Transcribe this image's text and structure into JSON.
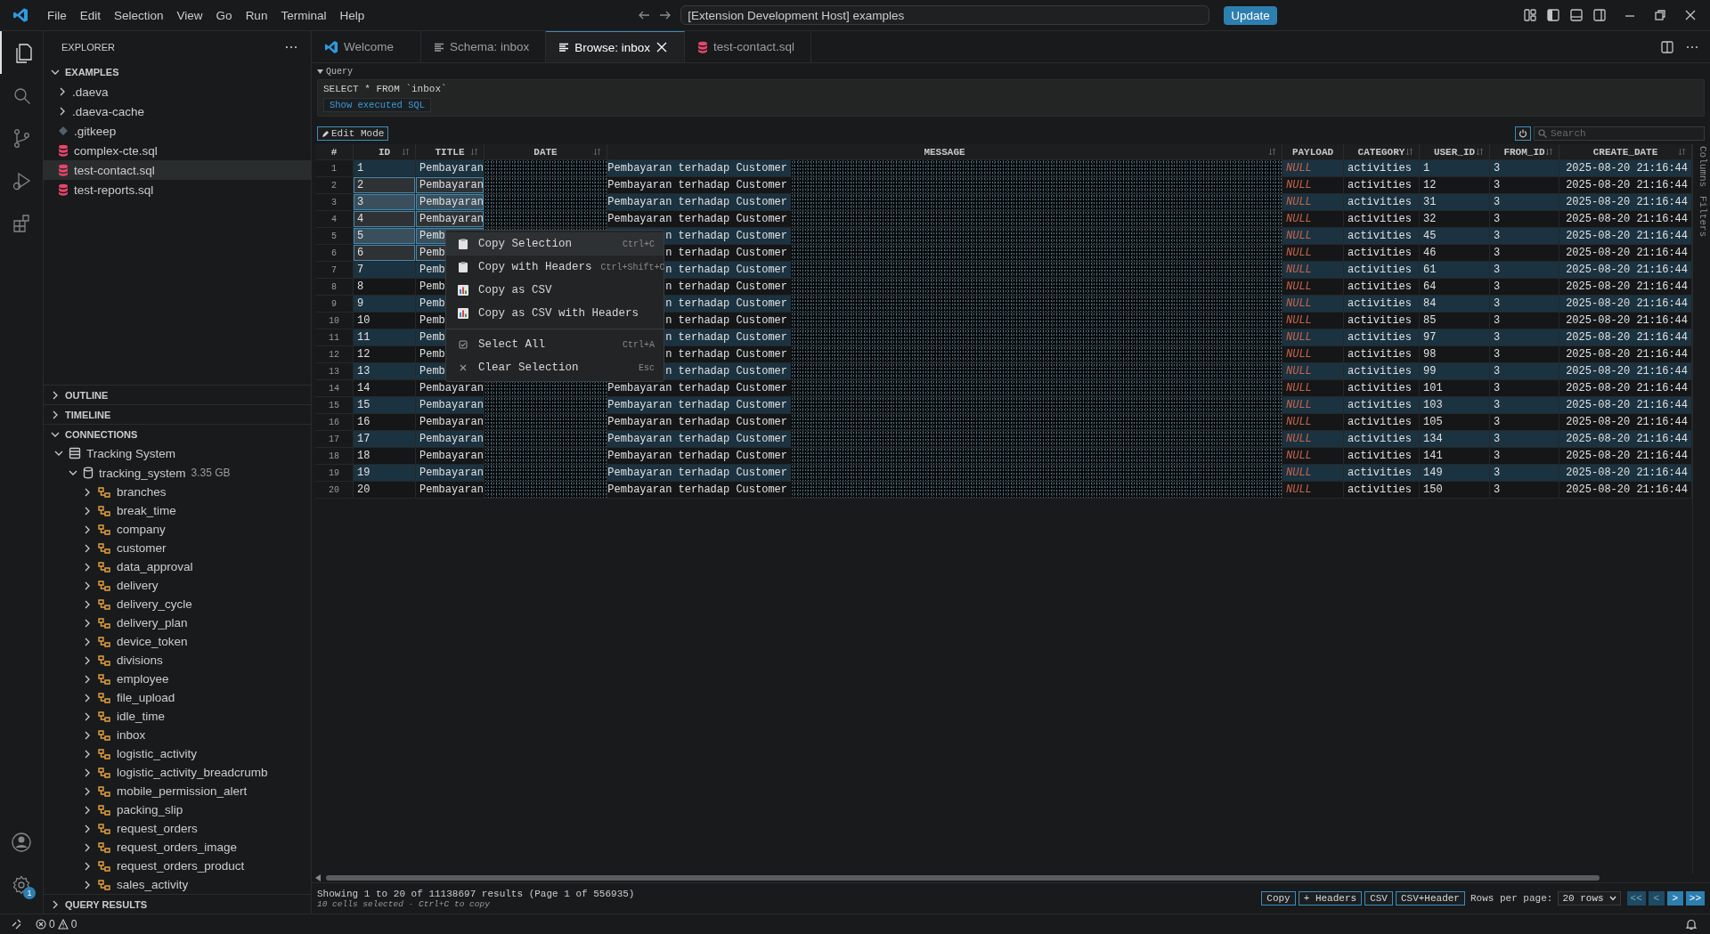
{
  "window": {
    "menu": [
      "File",
      "Edit",
      "Selection",
      "View",
      "Go",
      "Run",
      "Terminal",
      "Help"
    ],
    "command_center": "[Extension Development Host] examples",
    "update_button": "Update"
  },
  "activity_bar": [
    {
      "kind": "files",
      "selected": true
    },
    {
      "kind": "search",
      "selected": false
    },
    {
      "kind": "branch",
      "selected": false
    },
    {
      "kind": "debug",
      "selected": false
    },
    {
      "kind": "extensions",
      "selected": false
    }
  ],
  "settings_badge": "1",
  "sidebar": {
    "title": "EXPLORER",
    "folder": {
      "label": "EXAMPLES",
      "expanded": true,
      "children": [
        {
          "label": ".daeva",
          "kind": "folder",
          "selected": false
        },
        {
          "label": ".daeva-cache",
          "kind": "folder",
          "selected": false
        },
        {
          "label": ".gitkeep",
          "kind": "file",
          "selected": false
        },
        {
          "label": "complex-cte.sql",
          "kind": "sql",
          "selected": false
        },
        {
          "label": "test-contact.sql",
          "kind": "sql",
          "selected": true
        },
        {
          "label": "test-reports.sql",
          "kind": "sql",
          "selected": false
        }
      ]
    },
    "sections": [
      {
        "label": "OUTLINE",
        "expanded": false
      },
      {
        "label": "TIMELINE",
        "expanded": false
      }
    ],
    "connections": {
      "label": "CONNECTIONS",
      "expanded": true,
      "children": [
        {
          "label": "Tracking System",
          "expanded": true,
          "children": [
            {
              "label": "tracking_system",
              "size": "3.35 GB",
              "expanded": true,
              "children": [
                {
                  "label": "branches"
                },
                {
                  "label": "break_time"
                },
                {
                  "label": "company"
                },
                {
                  "label": "customer"
                },
                {
                  "label": "data_approval"
                },
                {
                  "label": "delivery"
                },
                {
                  "label": "delivery_cycle"
                },
                {
                  "label": "delivery_plan"
                },
                {
                  "label": "device_token"
                },
                {
                  "label": "divisions"
                },
                {
                  "label": "employee"
                },
                {
                  "label": "file_upload"
                },
                {
                  "label": "idle_time"
                },
                {
                  "label": "inbox"
                },
                {
                  "label": "logistic_activity"
                },
                {
                  "label": "logistic_activity_breadcrumb"
                },
                {
                  "label": "mobile_permission_alert"
                },
                {
                  "label": "packing_slip"
                },
                {
                  "label": "request_orders"
                },
                {
                  "label": "request_orders_image"
                },
                {
                  "label": "request_orders_product"
                },
                {
                  "label": "sales_activity"
                }
              ]
            }
          ]
        }
      ]
    },
    "bottom_section": {
      "label": "QUERY RESULTS",
      "expanded": false
    }
  },
  "tabs": [
    {
      "label": "Welcome",
      "kind": "vscode",
      "selected": false
    },
    {
      "label": "Schema: inbox",
      "kind": "list",
      "selected": false
    },
    {
      "label": "Browse: inbox",
      "kind": "list",
      "selected": true
    },
    {
      "label": "test-contact.sql",
      "kind": "sql",
      "selected": false
    }
  ],
  "query": {
    "label": "Query",
    "expanded": true,
    "sql": "SELECT * FROM `inbox`",
    "show_sql_button": "Show executed SQL"
  },
  "toolbar": {
    "edit_mode_button": "Edit Mode",
    "search": {
      "placeholder": "Search"
    }
  },
  "side_strip": [
    "Columns",
    "Filters"
  ],
  "table": {
    "columns": [
      {
        "label": "#",
        "sortable": false
      },
      {
        "label": "ID",
        "sortable": true
      },
      {
        "label": "TITLE",
        "sortable": true
      },
      {
        "label": "DATE",
        "sortable": true
      },
      {
        "label": "MESSAGE",
        "sortable": true
      },
      {
        "label": "PAYLOAD",
        "sortable": false
      },
      {
        "label": "CATEGORY",
        "sortable": true
      },
      {
        "label": "USER_ID",
        "sortable": true
      },
      {
        "label": "FROM_ID",
        "sortable": true
      },
      {
        "label": "CREATE_DATE",
        "sortable": true
      }
    ],
    "rows": [
      {
        "no": "1",
        "id": "1",
        "title": "Pembayaran",
        "message": "Pembayaran terhadap Customer",
        "payload": "NULL",
        "category": "activities",
        "user_id": "1",
        "from_id": "3",
        "create_date": "2025-08-20 21:16:44",
        "selected": false
      },
      {
        "no": "2",
        "id": "2",
        "title": "Pembayaran",
        "message": "Pembayaran terhadap Customer",
        "payload": "NULL",
        "category": "activities",
        "user_id": "12",
        "from_id": "3",
        "create_date": "2025-08-20 21:16:44",
        "selected": true
      },
      {
        "no": "3",
        "id": "3",
        "title": "Pembayaran",
        "message": "Pembayaran terhadap Customer",
        "payload": "NULL",
        "category": "activities",
        "user_id": "31",
        "from_id": "3",
        "create_date": "2025-08-20 21:16:44",
        "selected": true
      },
      {
        "no": "4",
        "id": "4",
        "title": "Pembayaran",
        "message": "Pembayaran terhadap Customer",
        "payload": "NULL",
        "category": "activities",
        "user_id": "32",
        "from_id": "3",
        "create_date": "2025-08-20 21:16:44",
        "selected": true
      },
      {
        "no": "5",
        "id": "5",
        "title": "Pemb",
        "message": "n terhadap Customer",
        "payload": "NULL",
        "category": "activities",
        "user_id": "45",
        "from_id": "3",
        "create_date": "2025-08-20 21:16:44",
        "selected": true
      },
      {
        "no": "6",
        "id": "6",
        "title": "Pemb",
        "message": "n terhadap Customer",
        "payload": "NULL",
        "category": "activities",
        "user_id": "46",
        "from_id": "3",
        "create_date": "2025-08-20 21:16:44",
        "selected": true
      },
      {
        "no": "7",
        "id": "7",
        "title": "Pemb",
        "message": "n terhadap Customer",
        "payload": "NULL",
        "category": "activities",
        "user_id": "61",
        "from_id": "3",
        "create_date": "2025-08-20 21:16:44",
        "selected": false
      },
      {
        "no": "8",
        "id": "8",
        "title": "Pemb",
        "message": "n terhadap Customer",
        "payload": "NULL",
        "category": "activities",
        "user_id": "64",
        "from_id": "3",
        "create_date": "2025-08-20 21:16:44",
        "selected": false
      },
      {
        "no": "9",
        "id": "9",
        "title": "Pemb",
        "message": "n terhadap Customer",
        "payload": "NULL",
        "category": "activities",
        "user_id": "84",
        "from_id": "3",
        "create_date": "2025-08-20 21:16:44",
        "selected": false
      },
      {
        "no": "10",
        "id": "10",
        "title": "Pemb",
        "message": "n terhadap Customer",
        "payload": "NULL",
        "category": "activities",
        "user_id": "85",
        "from_id": "3",
        "create_date": "2025-08-20 21:16:44",
        "selected": false
      },
      {
        "no": "11",
        "id": "11",
        "title": "Pemb",
        "message": "n terhadap Customer",
        "payload": "NULL",
        "category": "activities",
        "user_id": "97",
        "from_id": "3",
        "create_date": "2025-08-20 21:16:44",
        "selected": false
      },
      {
        "no": "12",
        "id": "12",
        "title": "Pemb",
        "message": "n terhadap Customer",
        "payload": "NULL",
        "category": "activities",
        "user_id": "98",
        "from_id": "3",
        "create_date": "2025-08-20 21:16:44",
        "selected": false
      },
      {
        "no": "13",
        "id": "13",
        "title": "Pemb",
        "message": "n terhadap Customer",
        "payload": "NULL",
        "category": "activities",
        "user_id": "99",
        "from_id": "3",
        "create_date": "2025-08-20 21:16:44",
        "selected": false
      },
      {
        "no": "14",
        "id": "14",
        "title": "Pembayaran",
        "message": "Pembayaran terhadap Customer",
        "payload": "NULL",
        "category": "activities",
        "user_id": "101",
        "from_id": "3",
        "create_date": "2025-08-20 21:16:44",
        "selected": false
      },
      {
        "no": "15",
        "id": "15",
        "title": "Pembayaran",
        "message": "Pembayaran terhadap Customer",
        "payload": "NULL",
        "category": "activities",
        "user_id": "103",
        "from_id": "3",
        "create_date": "2025-08-20 21:16:44",
        "selected": false
      },
      {
        "no": "16",
        "id": "16",
        "title": "Pembayaran",
        "message": "Pembayaran terhadap Customer",
        "payload": "NULL",
        "category": "activities",
        "user_id": "105",
        "from_id": "3",
        "create_date": "2025-08-20 21:16:44",
        "selected": false
      },
      {
        "no": "17",
        "id": "17",
        "title": "Pembayaran",
        "message": "Pembayaran terhadap Customer",
        "payload": "NULL",
        "category": "activities",
        "user_id": "134",
        "from_id": "3",
        "create_date": "2025-08-20 21:16:44",
        "selected": false
      },
      {
        "no": "18",
        "id": "18",
        "title": "Pembayaran",
        "message": "Pembayaran terhadap Customer",
        "payload": "NULL",
        "category": "activities",
        "user_id": "141",
        "from_id": "3",
        "create_date": "2025-08-20 21:16:44",
        "selected": false
      },
      {
        "no": "19",
        "id": "19",
        "title": "Pembayaran",
        "message": "Pembayaran terhadap Customer",
        "payload": "NULL",
        "category": "activities",
        "user_id": "149",
        "from_id": "3",
        "create_date": "2025-08-20 21:16:44",
        "selected": false
      },
      {
        "no": "20",
        "id": "20",
        "title": "Pembayaran",
        "message": "Pembayaran terhadap Customer",
        "payload": "NULL",
        "category": "activities",
        "user_id": "150",
        "from_id": "3",
        "create_date": "2025-08-20 21:16:44",
        "selected": false
      }
    ]
  },
  "context_menu": [
    {
      "kind": "clipboard",
      "label": "Copy Selection",
      "shortcut": "Ctrl+C",
      "highlighted": true
    },
    {
      "kind": "clipboard",
      "label": "Copy with Headers",
      "shortcut": "Ctrl+Shift+C",
      "highlighted": false
    },
    {
      "kind": "chart",
      "label": "Copy as CSV",
      "highlighted": false
    },
    {
      "kind": "chart",
      "label": "Copy as CSV with Headers",
      "highlighted": false
    },
    {
      "kind": "separator"
    },
    {
      "kind": "checkbox",
      "label": "Select All",
      "shortcut": "Ctrl+A",
      "highlighted": false
    },
    {
      "kind": "cross",
      "label": "Clear Selection",
      "shortcut": "Esc",
      "highlighted": false
    }
  ],
  "footer": {
    "summary": "Showing 1 to 20 of 11138697 results (Page 1 of 556935)",
    "selection_hint": "10 cells selected - Ctrl+C to copy",
    "copy_buttons": [
      "Copy",
      "+ Headers",
      "CSV",
      "CSV+Header"
    ],
    "rows_label": "Rows per page:",
    "rows_select": "20 rows",
    "pager": [
      {
        "label": "<<",
        "disabled": true
      },
      {
        "label": "<",
        "disabled": true
      },
      {
        "label": ">",
        "disabled": false
      },
      {
        "label": ">>",
        "disabled": false
      }
    ]
  },
  "status_bar": {
    "errors": "0",
    "warnings": "0"
  }
}
